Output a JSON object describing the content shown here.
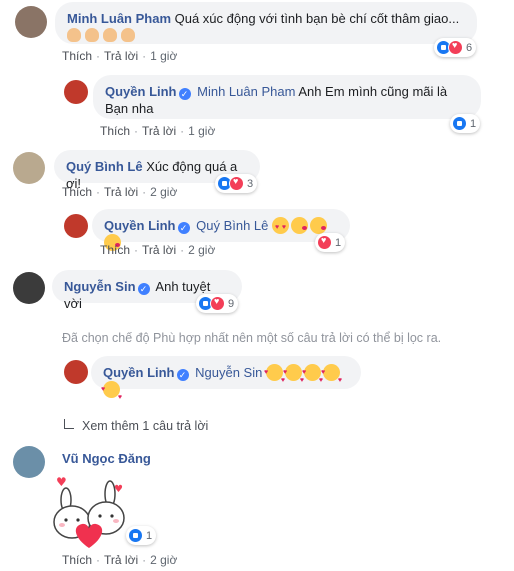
{
  "comments": [
    {
      "author": "Minh Luân Pham",
      "text": "Quá xúc động với tình bạn bè chí cốt thâm giao...",
      "like": "Thích",
      "reply": "Trả lời",
      "time": "1 giờ",
      "reaction_count": "6",
      "avatar_color": "#8a7466"
    },
    {
      "author": "Quyền Linh",
      "mention": "Minh Luân Pham",
      "text_line1": "Anh Em mình cũng mãi là",
      "text_line2": "Bạn nha",
      "like": "Thích",
      "reply": "Trả lời",
      "time": "1 giờ",
      "reaction_count": "1",
      "avatar_color": "#c0392b"
    },
    {
      "author": "Quý Bình Lê",
      "text": "Xúc động quá a ơi!",
      "like": "Thích",
      "reply": "Trả lời",
      "time": "2 giờ",
      "reaction_count": "3",
      "avatar_color": "#b9a98f"
    },
    {
      "author": "Quyền Linh",
      "mention": "Quý Bình Lê",
      "like": "Thích",
      "reply": "Trả lời",
      "time": "2 giờ",
      "reaction_count": "1",
      "avatar_color": "#c0392b"
    },
    {
      "author": "Nguyễn Sin",
      "text": "Anh tuyệt vời",
      "like": "Thích",
      "reply": "Trả lời",
      "time": "2 giờ",
      "reaction_count": "9",
      "avatar_color": "#3b3b3b"
    },
    {
      "author": "Quyền Linh",
      "mention": "Nguyễn Sin",
      "avatar_color": "#c0392b"
    },
    {
      "author": "Vũ Ngọc Đăng",
      "like": "Thích",
      "reply": "Trả lời",
      "time": "2 giờ",
      "reaction_count": "1",
      "avatar_color": "#6b8fa8"
    }
  ],
  "filter_notice": "Đã chọn chế độ Phù hợp nhất nên một số câu trả lời có thể bị lọc ra.",
  "view_more": "Xem thêm 1 câu trả lời",
  "colors": {
    "link": "#385898",
    "bubble": "#f2f3f5",
    "like": "#1877f2",
    "love": "#f33e58"
  }
}
